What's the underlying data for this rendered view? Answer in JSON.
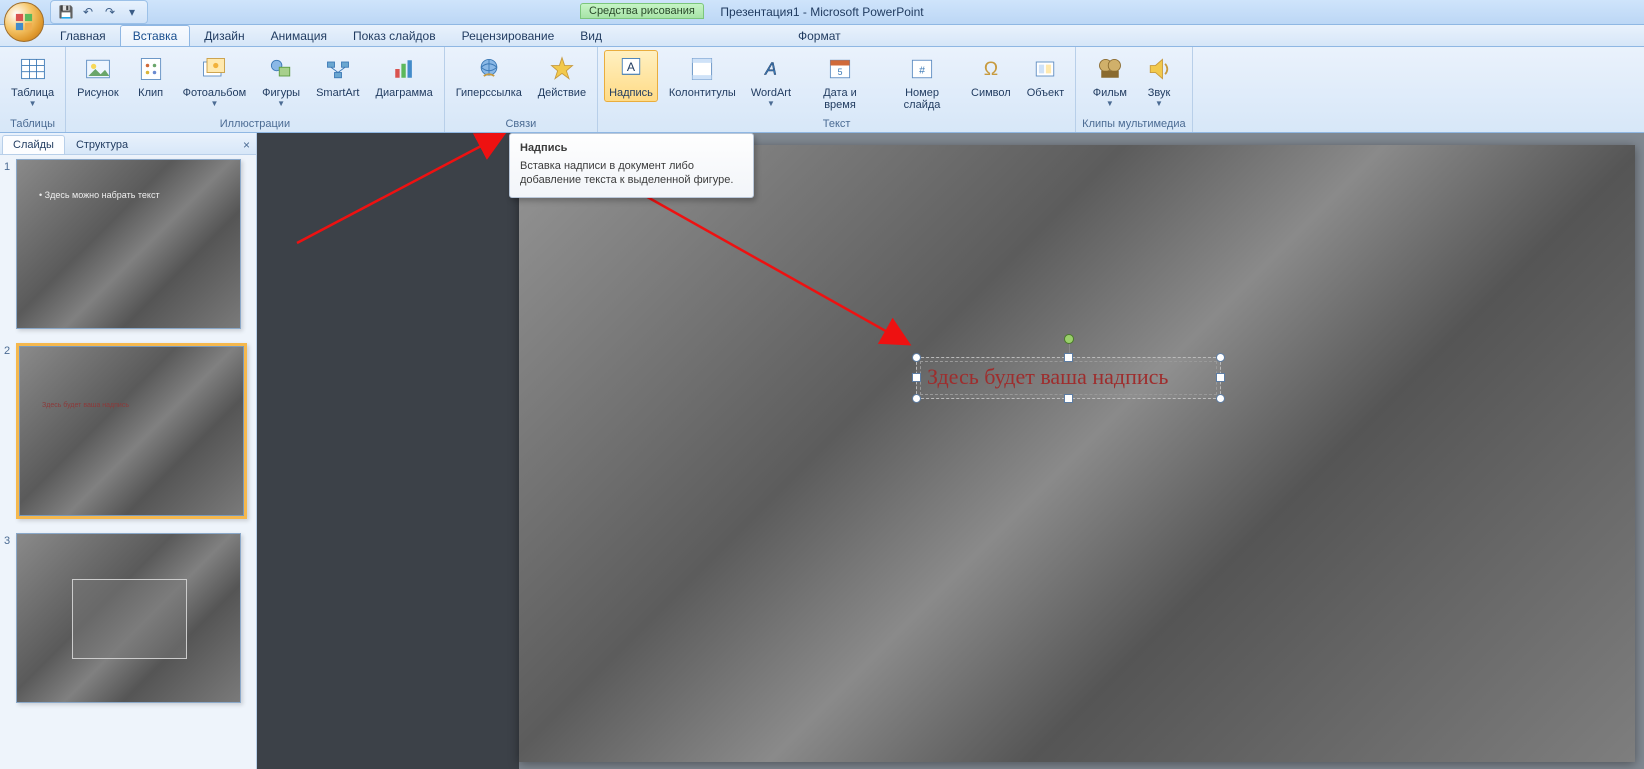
{
  "title": "Презентация1 - Microsoft PowerPoint",
  "context_tab": "Средства рисования",
  "qat": {
    "save": "💾",
    "undo": "↶",
    "redo": "↷",
    "more": "▾"
  },
  "tabs": [
    "Главная",
    "Вставка",
    "Дизайн",
    "Анимация",
    "Показ слайдов",
    "Рецензирование",
    "Вид",
    "Формат"
  ],
  "active_tab_index": 1,
  "ribbon": {
    "groups": [
      {
        "label": "Таблицы",
        "items": [
          {
            "id": "table",
            "label": "Таблица",
            "dd": true
          }
        ]
      },
      {
        "label": "Иллюстрации",
        "items": [
          {
            "id": "picture",
            "label": "Рисунок"
          },
          {
            "id": "clip",
            "label": "Клип"
          },
          {
            "id": "album",
            "label": "Фотоальбом",
            "dd": true
          },
          {
            "id": "shapes",
            "label": "Фигуры",
            "dd": true
          },
          {
            "id": "smartart",
            "label": "SmartArt"
          },
          {
            "id": "chart",
            "label": "Диаграмма"
          }
        ]
      },
      {
        "label": "Связи",
        "items": [
          {
            "id": "hyperlink",
            "label": "Гиперссылка"
          },
          {
            "id": "action",
            "label": "Действие"
          }
        ]
      },
      {
        "label": "Текст",
        "items": [
          {
            "id": "textbox",
            "label": "Надпись",
            "active": true
          },
          {
            "id": "headerfooter",
            "label": "Колонтитулы"
          },
          {
            "id": "wordart",
            "label": "WordArt",
            "dd": true
          },
          {
            "id": "datetime",
            "label": "Дата и время"
          },
          {
            "id": "slidenum",
            "label": "Номер слайда"
          },
          {
            "id": "symbol",
            "label": "Символ"
          },
          {
            "id": "object",
            "label": "Объект"
          }
        ]
      },
      {
        "label": "Клипы мультимедиа",
        "items": [
          {
            "id": "movie",
            "label": "Фильм",
            "dd": true
          },
          {
            "id": "sound",
            "label": "Звук",
            "dd": true
          }
        ]
      }
    ]
  },
  "side": {
    "tabs": [
      "Слайды",
      "Структура"
    ],
    "active": 0,
    "close": "×",
    "slide1_text": "Здесь можно набрать текст",
    "slide2_text": "Здесь будет ваша надпись"
  },
  "tooltip": {
    "title": "Надпись",
    "body": "Вставка надписи в документ либо добавление текста к выделенной фигуре."
  },
  "slide_text": "Здесь будет ваша надпись"
}
